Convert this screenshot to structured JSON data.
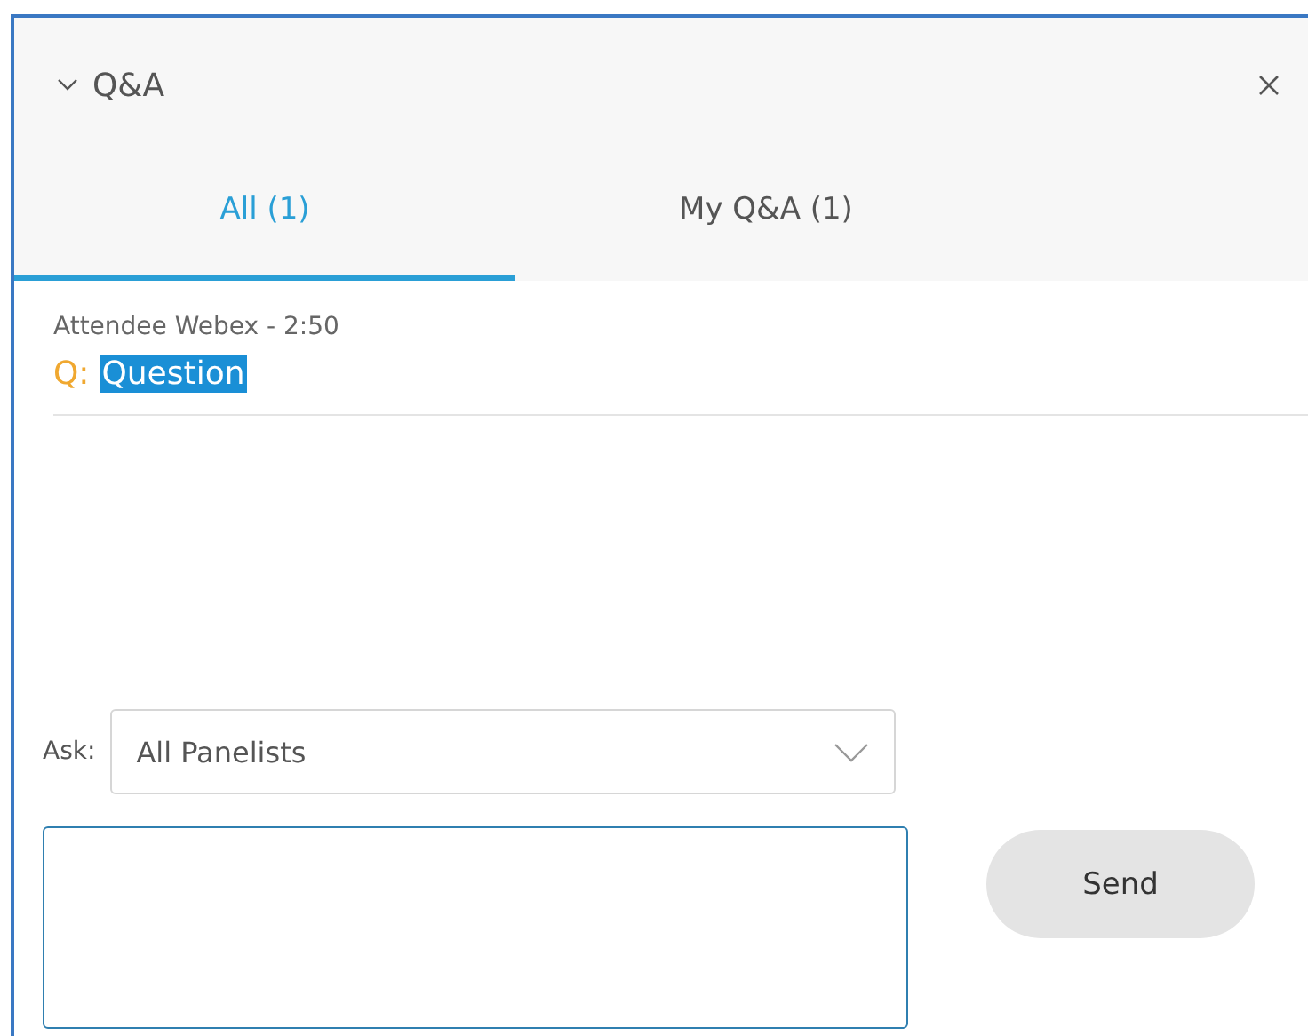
{
  "panel": {
    "title": "Q&A",
    "expanded": true
  },
  "tabs": [
    {
      "label": "All (1)",
      "selected": true
    },
    {
      "label": "My Q&A (1)",
      "selected": false
    }
  ],
  "questions": [
    {
      "meta": "Attendee Webex - 2:50",
      "prefix": "Q:",
      "text": "Question",
      "selected": true
    }
  ],
  "ask": {
    "label": "Ask:",
    "value": "All Panelists"
  },
  "send_button": "Send"
}
